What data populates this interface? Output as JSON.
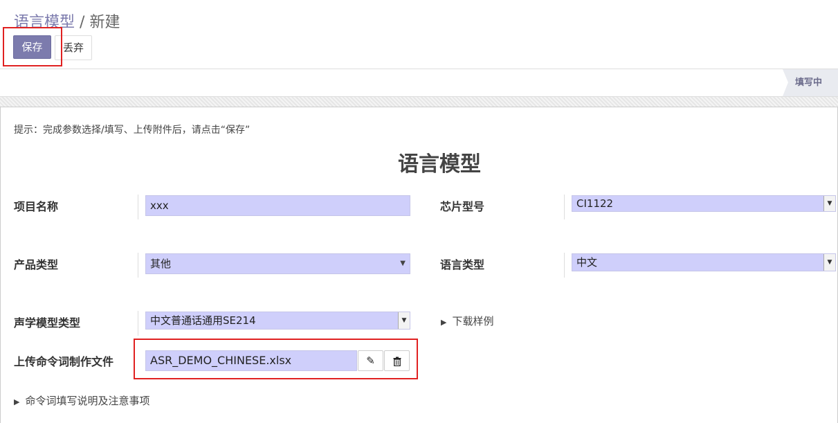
{
  "breadcrumb": {
    "parent": "语言模型",
    "separator": "/",
    "current": "新建"
  },
  "toolbar": {
    "save_label": "保存",
    "discard_label": "丢弃"
  },
  "status": {
    "label": "填写中"
  },
  "form": {
    "hint": "提示：完成参数选择/填写、上传附件后，请点击“保存”",
    "title": "语言模型",
    "fields": {
      "project_name": {
        "label": "项目名称",
        "value": "xxx"
      },
      "chip_model": {
        "label": "芯片型号",
        "value": "CI1122"
      },
      "product_type": {
        "label": "产品类型",
        "value": "其他"
      },
      "language_type": {
        "label": "语言类型",
        "value": "中文"
      },
      "acoustic_model": {
        "label": "声学模型类型",
        "value": "中文普通话通用SE214"
      },
      "upload_file": {
        "label": "上传命令词制作文件",
        "value": "ASR_DEMO_CHINESE.xlsx"
      }
    },
    "download_sample": "下载样例",
    "instructions": "命令词填写说明及注意事项"
  },
  "icons": {
    "edit": "pencil-icon",
    "delete": "trash-icon",
    "dropdown": "chevron-down-icon"
  },
  "colors": {
    "accent": "#7c7bad",
    "field_bg": "#cfcffb",
    "highlight": "#e02020"
  }
}
